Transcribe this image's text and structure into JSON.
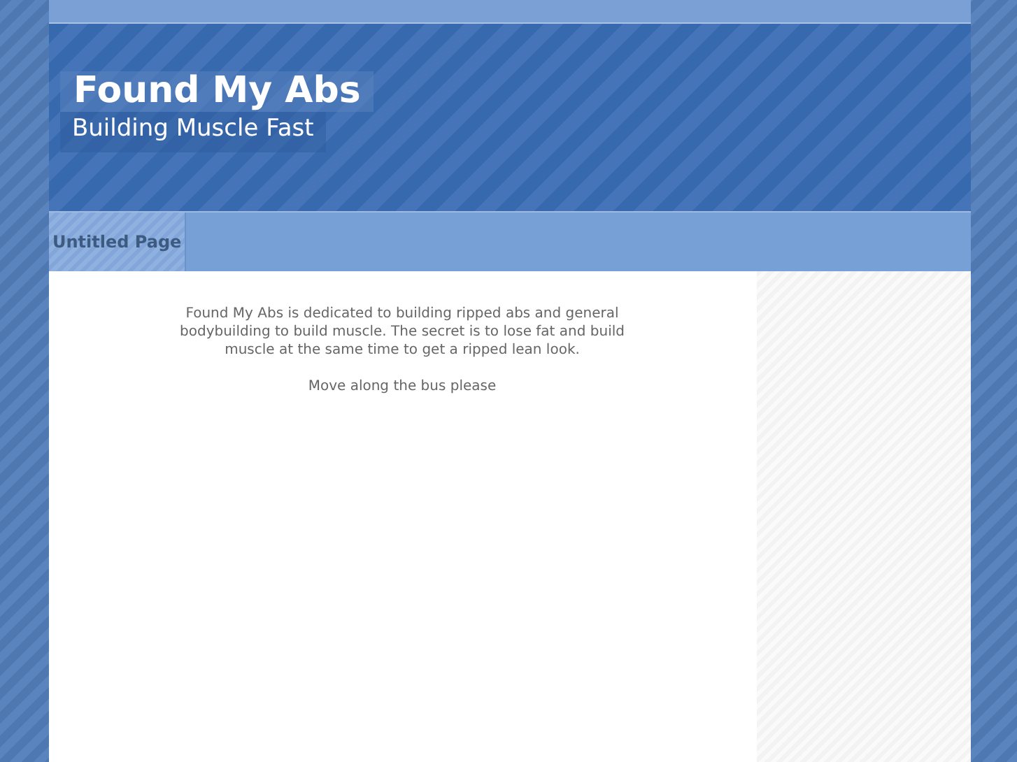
{
  "header": {
    "title": "Found My Abs",
    "tagline": "Building Muscle Fast"
  },
  "nav": [
    {
      "label": "Untitled Page",
      "selected": true
    }
  ],
  "content": {
    "paragraphs": [
      "Found My Abs is dedicated to building ripped abs and general bodybuilding to build muscle. The secret is to lose fat and build muscle at the same time to get a ripped lean look.",
      "Move along the bus please"
    ]
  }
}
